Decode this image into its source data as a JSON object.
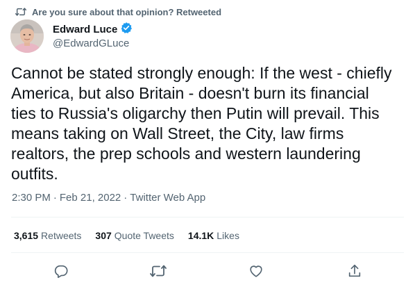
{
  "social_context": {
    "icon": "retweet-icon",
    "text": "Are you sure about that opinion? Retweeted"
  },
  "author": {
    "display_name": "Edward Luce",
    "handle": "@EdwardGLuce",
    "verified": true,
    "verified_color": "#1d9bf0"
  },
  "tweet": {
    "lines": [
      "Cannot be stated strongly enough: If the west - chiefly",
      "America, but also Britain - doesn't burn its financial",
      "ties to Russia's oligarchy then Putin will prevail. This",
      "means taking on Wall Street, the City, law firms",
      "realtors, the prep schools and western laundering",
      "outfits."
    ]
  },
  "meta": {
    "time": "2:30 PM",
    "separator": "·",
    "date": "Feb 21, 2022",
    "source": "Twitter Web App"
  },
  "stats": {
    "retweets_count": "3,615",
    "retweets_label": "Retweets",
    "quotes_count": "307",
    "quotes_label": "Quote Tweets",
    "likes_count": "14.1K",
    "likes_label": "Likes"
  },
  "actions": {
    "reply_icon": "reply-icon",
    "retweet_icon": "retweet-icon",
    "like_icon": "heart-icon",
    "share_icon": "share-icon",
    "icon_color": "#536471"
  }
}
